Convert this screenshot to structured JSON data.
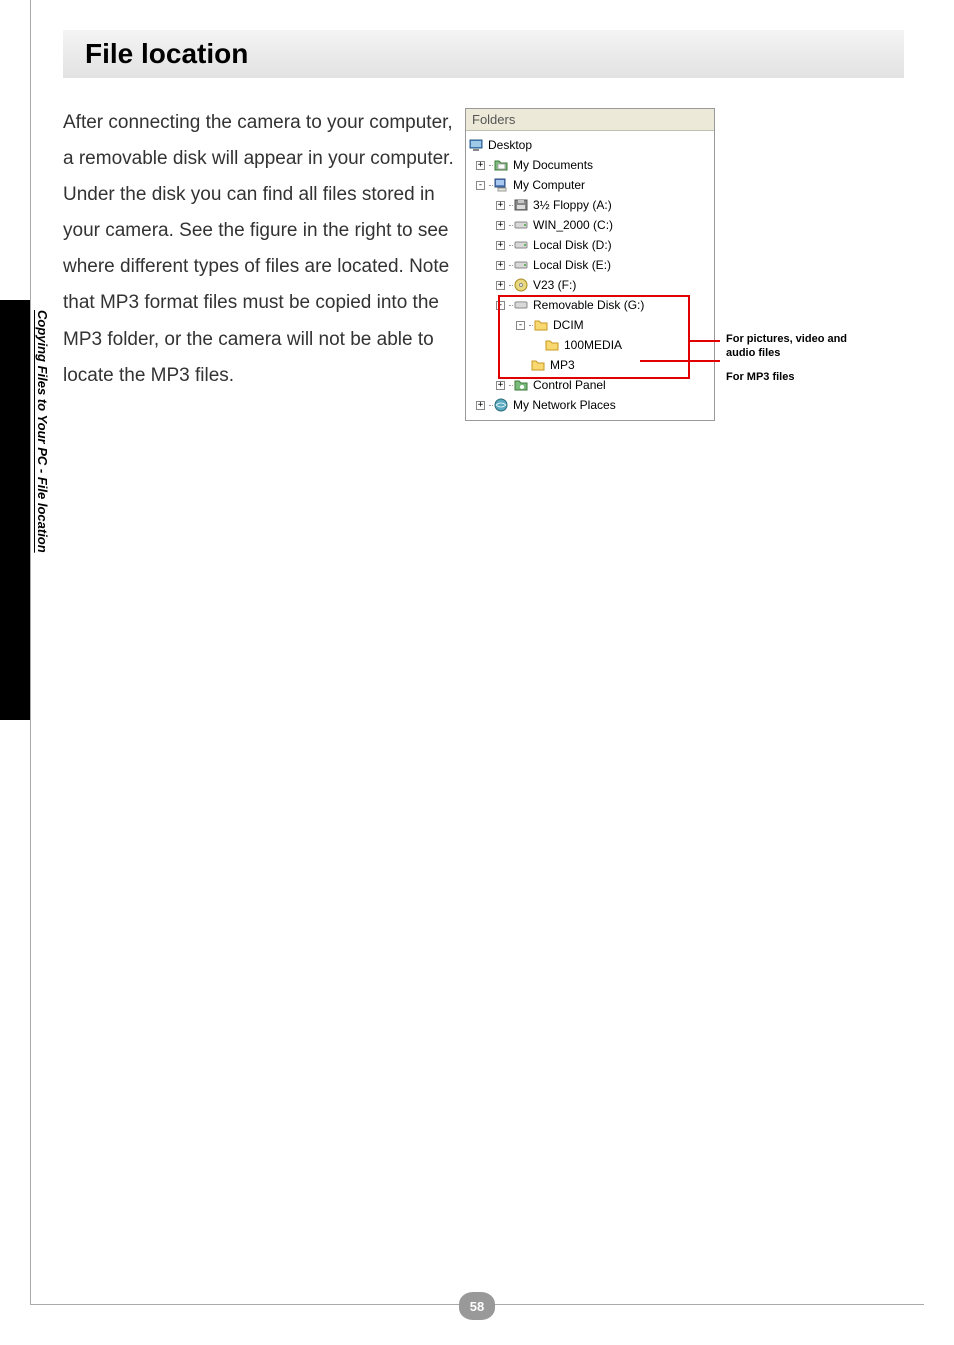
{
  "heading": "File location",
  "sidebar_text": "Copying Files to Your PC - File location",
  "body_paragraph": "After connecting the camera to your computer, a removable disk will appear in your computer. Under the disk you can find all files stored in your camera. See the figure in the right to see where different types of files are located. Note that MP3 format files must be copied into the MP3 folder, or the camera will not be able to locate the MP3 files.",
  "figure": {
    "header": "Folders",
    "tree": {
      "root": "Desktop",
      "my_documents": "My Documents",
      "my_computer": "My Computer",
      "floppy": "3½ Floppy (A:)",
      "win2000": "WIN_2000 (C:)",
      "localD": "Local Disk (D:)",
      "localE": "Local Disk (E:)",
      "v23": "V23 (F:)",
      "removable": "Removable Disk (G:)",
      "dcim": "DCIM",
      "media100": "100MEDIA",
      "mp3": "MP3",
      "control_panel": "Control Panel",
      "network": "My Network Places"
    }
  },
  "callouts": {
    "media": "For pictures, video and audio files",
    "mp3": "For MP3 files"
  },
  "page_number": "58"
}
